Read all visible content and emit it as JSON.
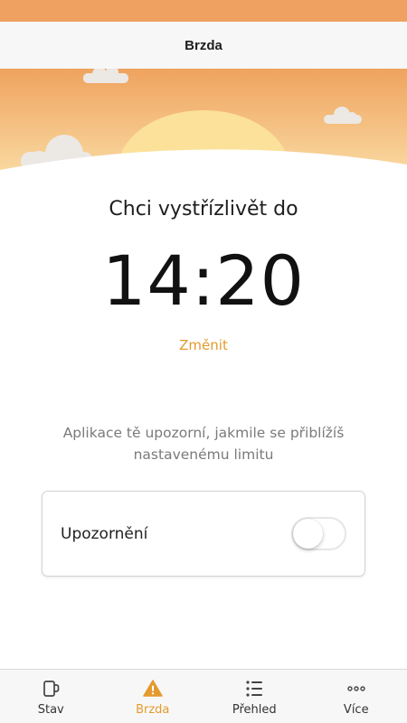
{
  "colors": {
    "accent": "#e49a2e",
    "status_strip": "#efa161",
    "sky_top": "#efa35e",
    "sky_bottom": "#f9d9a1",
    "sun": "#fbe19a",
    "cloud": "#ece8e3"
  },
  "nav": {
    "title": "Brzda"
  },
  "goal": {
    "label": "Chci vystřízlivět do",
    "time": "14:20",
    "change_label": "Změnit"
  },
  "info": {
    "text": "Aplikace tě upozorní, jakmile se přiblížíš nastavenému limitu"
  },
  "notification": {
    "label": "Upozornění",
    "enabled": false
  },
  "tabs": [
    {
      "label": "Stav",
      "icon": "mug-icon",
      "active": false
    },
    {
      "label": "Brzda",
      "icon": "warning-icon",
      "active": true
    },
    {
      "label": "Přehled",
      "icon": "list-icon",
      "active": false
    },
    {
      "label": "Více",
      "icon": "more-dots-icon",
      "active": false
    }
  ]
}
